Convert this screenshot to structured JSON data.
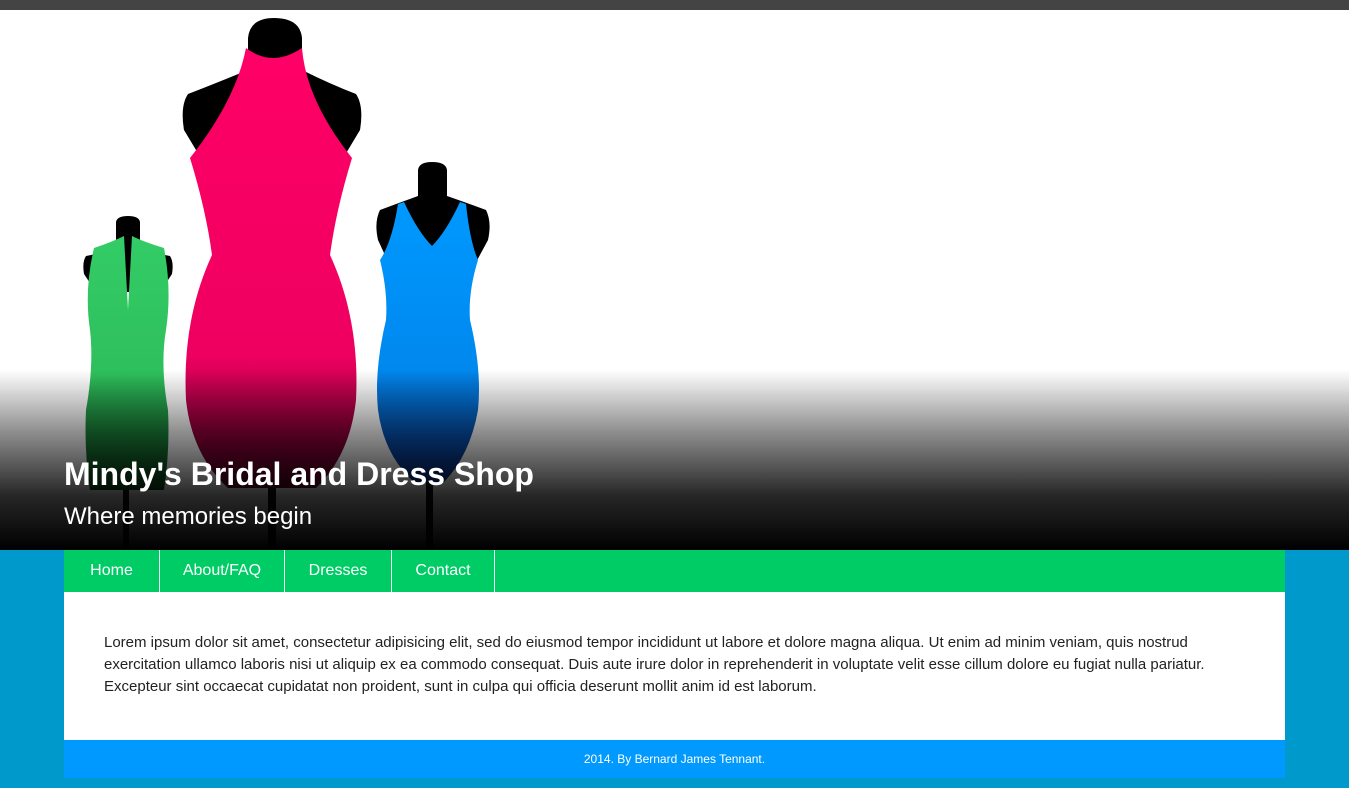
{
  "header": {
    "title": "Mindy's Bridal and Dress Shop",
    "tagline": "Where memories begin"
  },
  "nav": {
    "items": [
      {
        "label": "Home"
      },
      {
        "label": "About/FAQ"
      },
      {
        "label": "Dresses"
      },
      {
        "label": "Contact"
      }
    ]
  },
  "main": {
    "text": "Lorem ipsum dolor sit amet, consectetur adipisicing elit, sed do eiusmod tempor incididunt ut labore et dolore magna aliqua. Ut enim ad minim veniam, quis nostrud exercitation ullamco laboris nisi ut aliquip ex ea commodo consequat. Duis aute irure dolor in reprehenderit in voluptate velit esse cillum dolore eu fugiat nulla pariatur. Excepteur sint occaecat cupidatat non proident, sunt in culpa qui officia deserunt mollit anim id est laborum."
  },
  "footer": {
    "text": "2014. By Bernard James Tennant."
  },
  "colors": {
    "page_background": "#0099cc",
    "top_bar": "#444444",
    "nav_background": "#00cc66",
    "footer_background": "#0099ff",
    "dress_green": "#33cc66",
    "dress_pink": "#ff0066",
    "dress_blue": "#0099ff"
  },
  "hero_image": {
    "subject": "three dress mannequins"
  }
}
